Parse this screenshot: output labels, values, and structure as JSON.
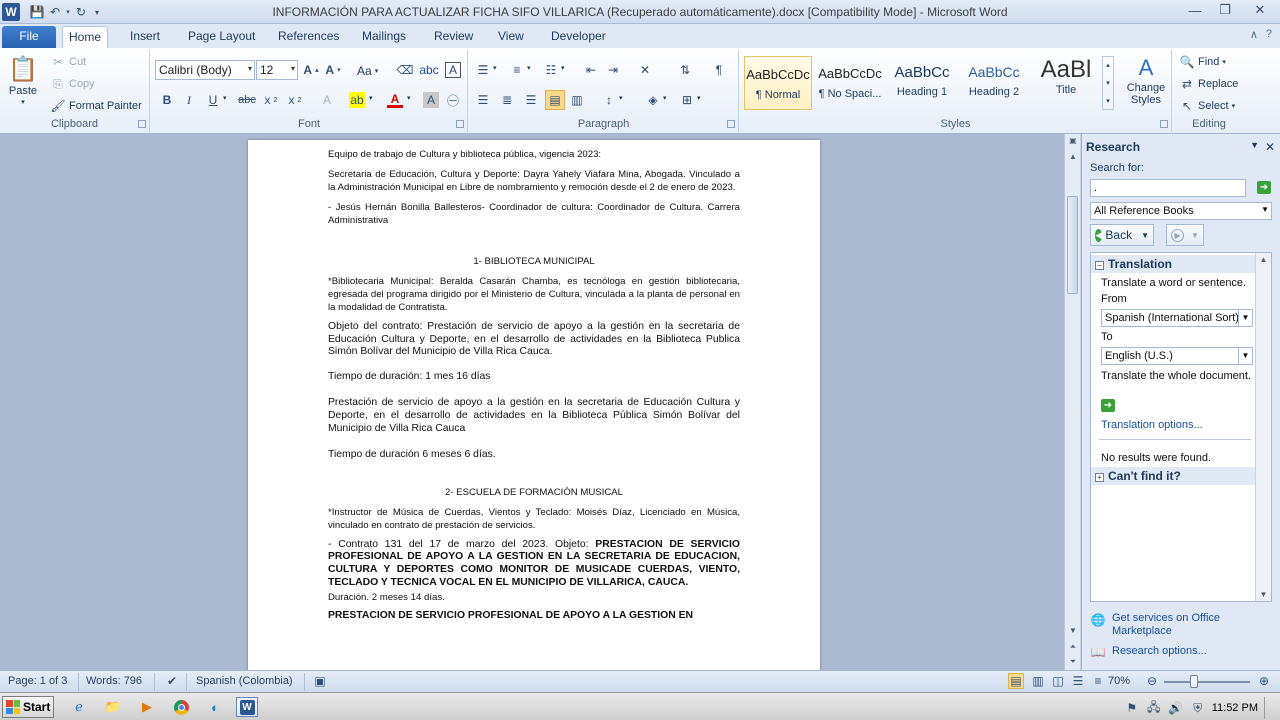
{
  "window": {
    "title": "INFORMACIÓN PARA ACTUALIZAR FICHA SIFO VILLARICA (Recuperado automáticamente).docx [Compatibility Mode]  -  Microsoft Word",
    "app_logo": "W"
  },
  "tabs": [
    "File",
    "Home",
    "Insert",
    "Page Layout",
    "References",
    "Mailings",
    "Review",
    "View",
    "Developer"
  ],
  "ribbon": {
    "clipboard": {
      "paste": "Paste",
      "cut": "Cut",
      "copy": "Copy",
      "format_painter": "Format Painter",
      "label": "Clipboard"
    },
    "font": {
      "name": "Calibri (Body)",
      "size": "12",
      "change_case": "Aa",
      "label": "Font"
    },
    "paragraph": {
      "label": "Paragraph"
    },
    "styles": {
      "items": [
        {
          "sample": "AaBbCcDc",
          "name": "¶ Normal"
        },
        {
          "sample": "AaBbCcDc",
          "name": "¶ No Spaci..."
        },
        {
          "sample": "AaBbCc",
          "name": "Heading 1"
        },
        {
          "sample": "AaBbCc",
          "name": "Heading 2"
        },
        {
          "sample": "AaBl",
          "name": "Title"
        }
      ],
      "change_styles": "Change Styles",
      "label": "Styles"
    },
    "editing": {
      "find": "Find",
      "replace": "Replace",
      "select": "Select",
      "label": "Editing"
    }
  },
  "document": {
    "p1": "Equipo de trabajo de Cultura y biblioteca pública, vigencia 2023:",
    "p2": "Secretaria de Educación, Cultura y Deporte: Dayra Yahely Viafara Mina, Abogada. Vinculado a la Administración Municipal en Libre de nombramiento y remoción desde el 2 de enero de 2023.",
    "p3": "- Jesús Hernán Bonilla Ballesteros- Coordinador de cultura: Coordinador de Cultura. Carrera Administrativa",
    "h1": "1- BIBLIOTECA MUNICIPAL",
    "p4": "*Bibliotecaria Municipal: Beralda Casarán Chamba, es tecnóloga en gestión bibliotecaria, egresada del programa dirigido por el Ministerio de Cultura, vinculada a la planta de personal en la modalidad de Contratista.",
    "p5": "Objeto del contrato: Prestación de servicio de apoyo a la gestión en la secretaria de Educación Cultura y Deporte, en el desarrollo de actividades en la Biblioteca Publica Simón Bolívar del Municipio de Villa Rica Cauca.",
    "p6": "Tiempo de duración:  1 mes 16 días",
    "p7": "Prestación de servicio de apoyo a la gestión en la secretaria de Educación Cultura y Deporte, en el desarrollo de actividades en la Biblioteca Pública Simón Bolívar del Municipio de Villa Rica Cauca",
    "p8": "Tiempo de duración 6 meses 6 días.",
    "h2": "2- ESCUELA DE FORMACIÓN MUSICAL",
    "p9": "*Instructor de Música de Cuerdas, Vientos y Teclado: Moisés Díaz, Licenciado en Música, vinculado en contrato de prestación de servicios.",
    "p10_prefix": "- Contrato 131 del 17 de marzo del 2023. Objeto: ",
    "p10_bold": "PRESTACION DE SERVICIO PROFESIONAL DE APOYO A LA GESTION EN LA SECRETARIA DE EDUCACION, CULTURA Y DEPORTES COMO MONITOR DE MUSICADE CUERDAS, VIENTO, TECLADO Y TECNICA VOCAL EN EL MUNICIPIO DE VILLARICA, CAUCA.",
    "p11": "Duración. 2 meses 14 días.",
    "p12_bold": "PRESTACION DE SERVICIO PROFESIONAL DE APOYO A LA GESTION EN"
  },
  "research": {
    "title": "Research",
    "search_for_label": "Search for:",
    "search_value": ".",
    "source": "All Reference Books",
    "back": "Back",
    "translation_header": "Translation",
    "translate_hint": "Translate a word or sentence.",
    "from_label": "From",
    "from_value": "Spanish (International Sort)",
    "to_label": "To",
    "to_value": "English (U.S.)",
    "translate_doc": "Translate the whole document.",
    "translation_options": "Translation options...",
    "no_results": "No results were found.",
    "cant_find": "Can't find it?",
    "get_services": "Get services on Office Marketplace",
    "research_options": "Research options..."
  },
  "status": {
    "page": "Page: 1 of 3",
    "words": "Words: 796",
    "language": "Spanish (Colombia)",
    "zoom": "70%"
  },
  "taskbar": {
    "start": "Start",
    "time": "11:52 PM"
  }
}
